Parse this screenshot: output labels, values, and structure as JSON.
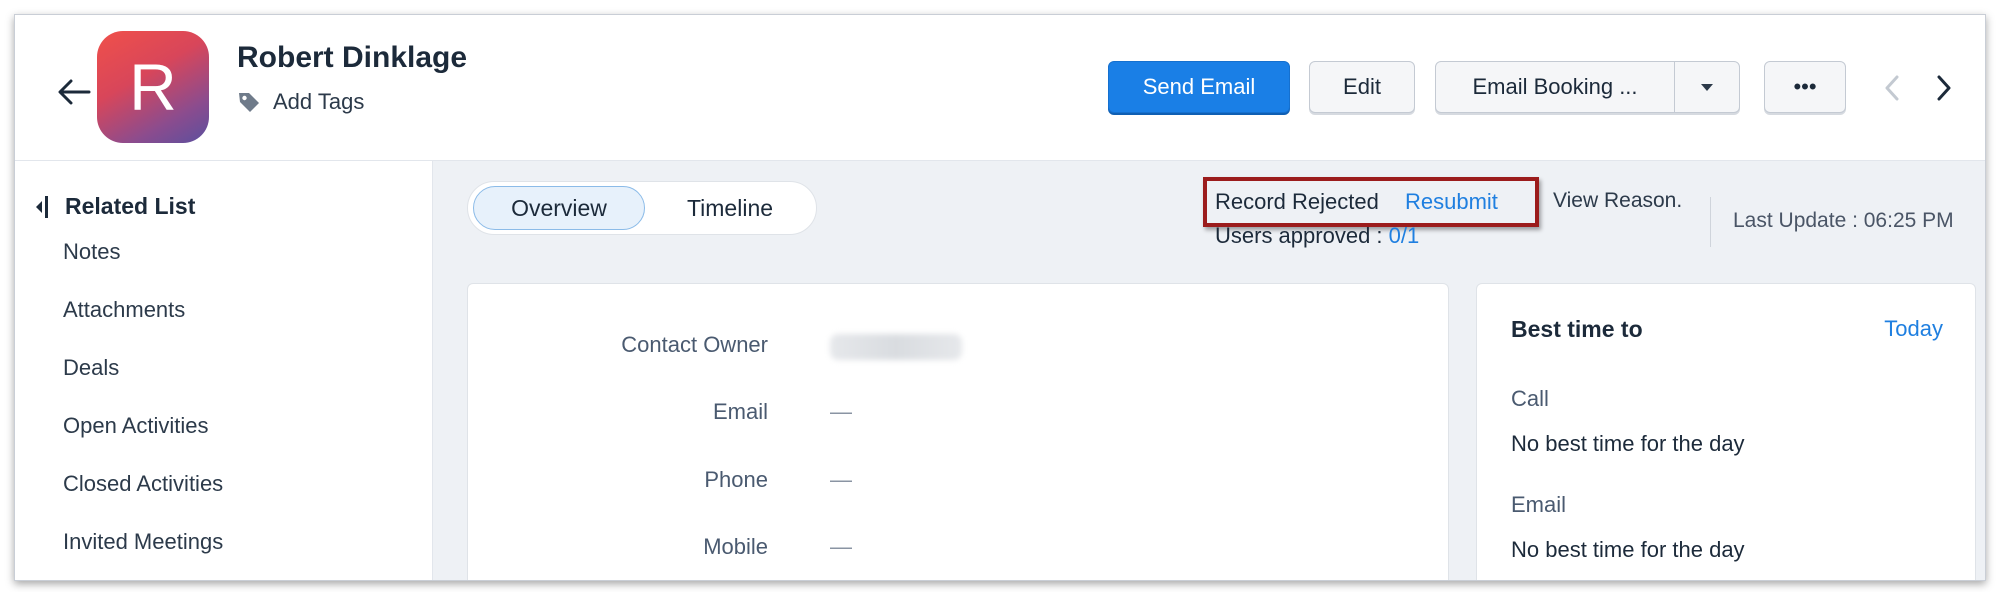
{
  "record": {
    "avatar_letter": "R",
    "name": "Robert Dinklage",
    "add_tags_label": "Add Tags"
  },
  "toolbar": {
    "send_email": "Send Email",
    "edit": "Edit",
    "email_booking": "Email Booking ...",
    "more": "•••"
  },
  "sidebar": {
    "heading": "Related List",
    "items": [
      "Notes",
      "Attachments",
      "Deals",
      "Open Activities",
      "Closed Activities",
      "Invited Meetings"
    ]
  },
  "tabs": [
    "Overview",
    "Timeline"
  ],
  "approval": {
    "status": "Record Rejected",
    "resubmit": "Resubmit",
    "view_reason": "View Reason.",
    "users_approved_label": "Users approved :",
    "users_approved_count": "0/1"
  },
  "last_update": "Last Update : 06:25 PM",
  "fields": [
    {
      "label": "Contact Owner",
      "value": ""
    },
    {
      "label": "Email",
      "value": "—"
    },
    {
      "label": "Phone",
      "value": "—"
    },
    {
      "label": "Mobile",
      "value": "—"
    }
  ],
  "best_time": {
    "title": "Best time to",
    "day": "Today",
    "call_label": "Call",
    "call_text": "No best time for the day",
    "email_label": "Email",
    "email_text": "No best time for the day"
  },
  "colors": {
    "primary": "#1a7fe6",
    "link": "#1f7fe0",
    "rejected_border": "#9b1c1c",
    "main_bg": "#eef1f5"
  }
}
